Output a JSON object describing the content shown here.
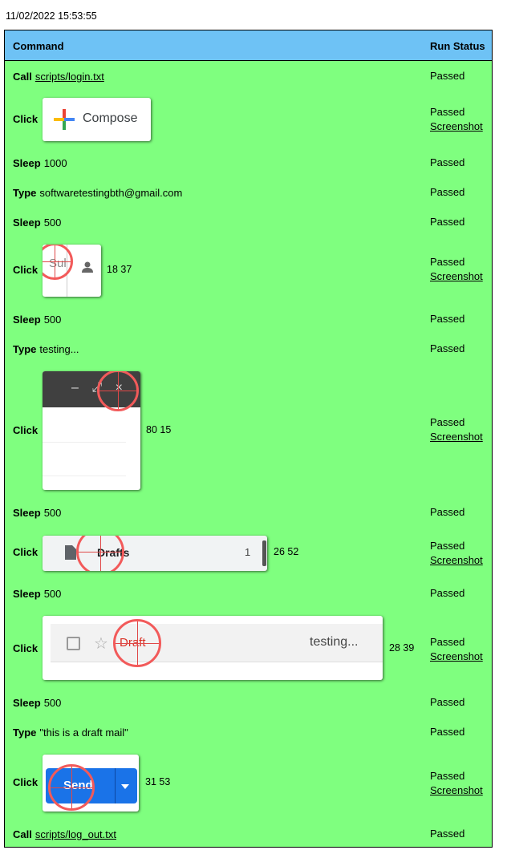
{
  "timestamp": "11/02/2022 15:53:55",
  "header": {
    "command": "Command",
    "run_status": "Run Status"
  },
  "rows": [
    {
      "action": "Call",
      "arg": "scripts/login.txt",
      "status": "Passed"
    },
    {
      "action": "Click",
      "thumb_text": "Compose",
      "status": "Passed",
      "screenshot": "Screenshot"
    },
    {
      "action": "Sleep",
      "arg": "1000",
      "status": "Passed"
    },
    {
      "action": "Type",
      "arg": "softwaretestingbth@gmail.com",
      "status": "Passed"
    },
    {
      "action": "Sleep",
      "arg": "500",
      "status": "Passed"
    },
    {
      "action": "Click",
      "thumb_text": "Sul",
      "coords": "18 37",
      "status": "Passed",
      "screenshot": "Screenshot"
    },
    {
      "action": "Sleep",
      "arg": "500",
      "status": "Passed"
    },
    {
      "action": "Type",
      "arg": "testing...",
      "status": "Passed"
    },
    {
      "action": "Click",
      "thumb_text": "– ⤢ ×",
      "coords": "80 15",
      "status": "Passed",
      "screenshot": "Screenshot"
    },
    {
      "action": "Sleep",
      "arg": "500",
      "status": "Passed"
    },
    {
      "action": "Click",
      "thumb_text": "Drafts",
      "thumb_count": "1",
      "coords": "26 52",
      "status": "Passed",
      "screenshot": "Screenshot"
    },
    {
      "action": "Sleep",
      "arg": "500",
      "status": "Passed"
    },
    {
      "action": "Click",
      "thumb_text": "Draft",
      "thumb_subject": "testing...",
      "coords": "28 39",
      "status": "Passed",
      "screenshot": "Screenshot"
    },
    {
      "action": "Sleep",
      "arg": "500",
      "status": "Passed"
    },
    {
      "action": "Type",
      "arg": "\"this is a draft mail\"",
      "status": "Passed"
    },
    {
      "action": "Click",
      "thumb_text": "Send",
      "coords": "31 53",
      "status": "Passed",
      "screenshot": "Screenshot"
    },
    {
      "action": "Call",
      "arg": "scripts/log_out.txt",
      "status": "Passed"
    }
  ],
  "colors": {
    "header_bg": "#6ec2f5",
    "table_bg": "#7fff7f",
    "target_ring": "#f25a5a",
    "send_blue": "#1a73e8"
  }
}
